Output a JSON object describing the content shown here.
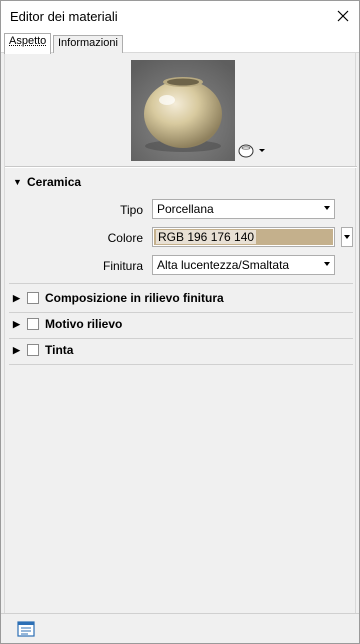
{
  "window": {
    "title": "Editor dei materiali",
    "close_icon": "close-icon"
  },
  "tabs": [
    {
      "label": "Aspetto",
      "active": true
    },
    {
      "label": "Informazioni",
      "active": false
    }
  ],
  "preview": {
    "shape_icon": "sphere-shape-icon"
  },
  "sections": {
    "ceramica": {
      "label": "Ceramica",
      "expanded": true,
      "fields": {
        "tipo": {
          "label": "Tipo",
          "value": "Porcellana"
        },
        "colore": {
          "label": "Colore",
          "value": "RGB 196 176 140",
          "color": "#c4b08c"
        },
        "finitura": {
          "label": "Finitura",
          "value": "Alta lucentezza/Smaltata"
        }
      }
    },
    "composizione": {
      "label": "Composizione in rilievo finitura",
      "checked": false
    },
    "motivo": {
      "label": "Motivo rilievo",
      "checked": false
    },
    "tinta": {
      "label": "Tinta",
      "checked": false
    }
  },
  "footer": {
    "icon": "material-browser-icon"
  },
  "colors": {
    "accent_blue": "#2c6fb5",
    "panel_bg": "#f0f0f0"
  }
}
